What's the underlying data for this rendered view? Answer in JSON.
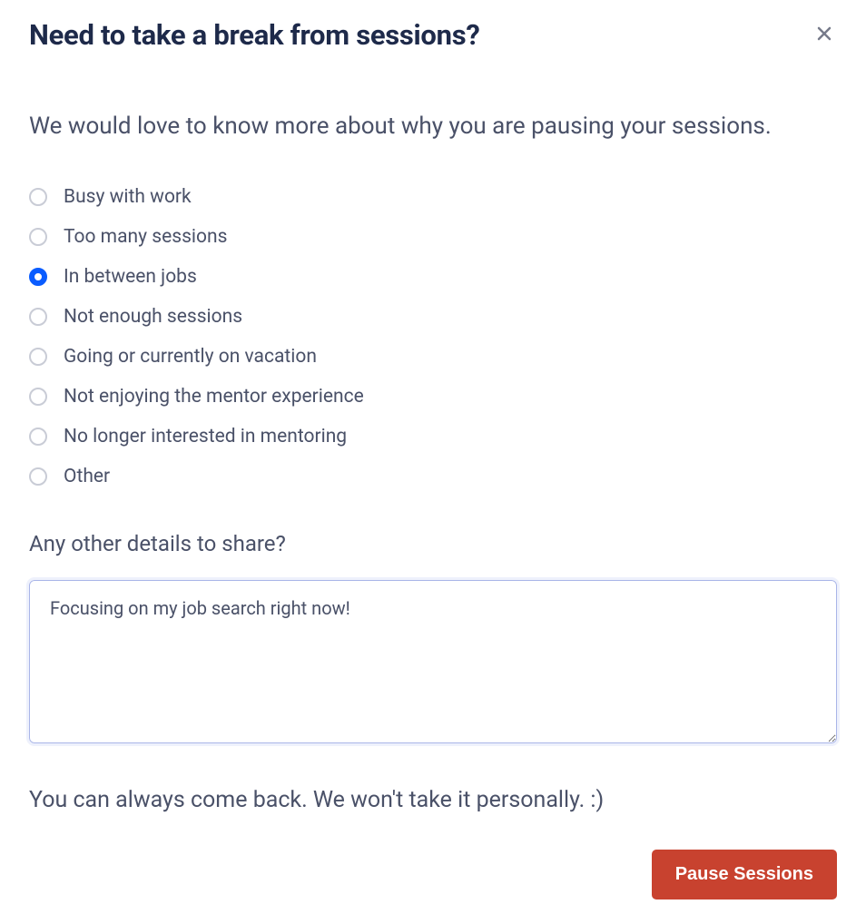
{
  "header": {
    "title": "Need to take a break from sessions?"
  },
  "subtitle": "We would love to know more about why you are pausing your sessions.",
  "reasons": {
    "options": [
      {
        "label": "Busy with work",
        "selected": false
      },
      {
        "label": "Too many sessions",
        "selected": false
      },
      {
        "label": "In between jobs",
        "selected": true
      },
      {
        "label": "Not enough sessions",
        "selected": false
      },
      {
        "label": "Going or currently on vacation",
        "selected": false
      },
      {
        "label": "Not enjoying the mentor experience",
        "selected": false
      },
      {
        "label": "No longer interested in mentoring",
        "selected": false
      },
      {
        "label": "Other",
        "selected": false
      }
    ]
  },
  "details": {
    "label": "Any other details to share?",
    "value": "Focusing on my job search right now!"
  },
  "footer": {
    "note": "You can always come back. We won't take it personally. :)",
    "pause_label": "Pause Sessions"
  }
}
